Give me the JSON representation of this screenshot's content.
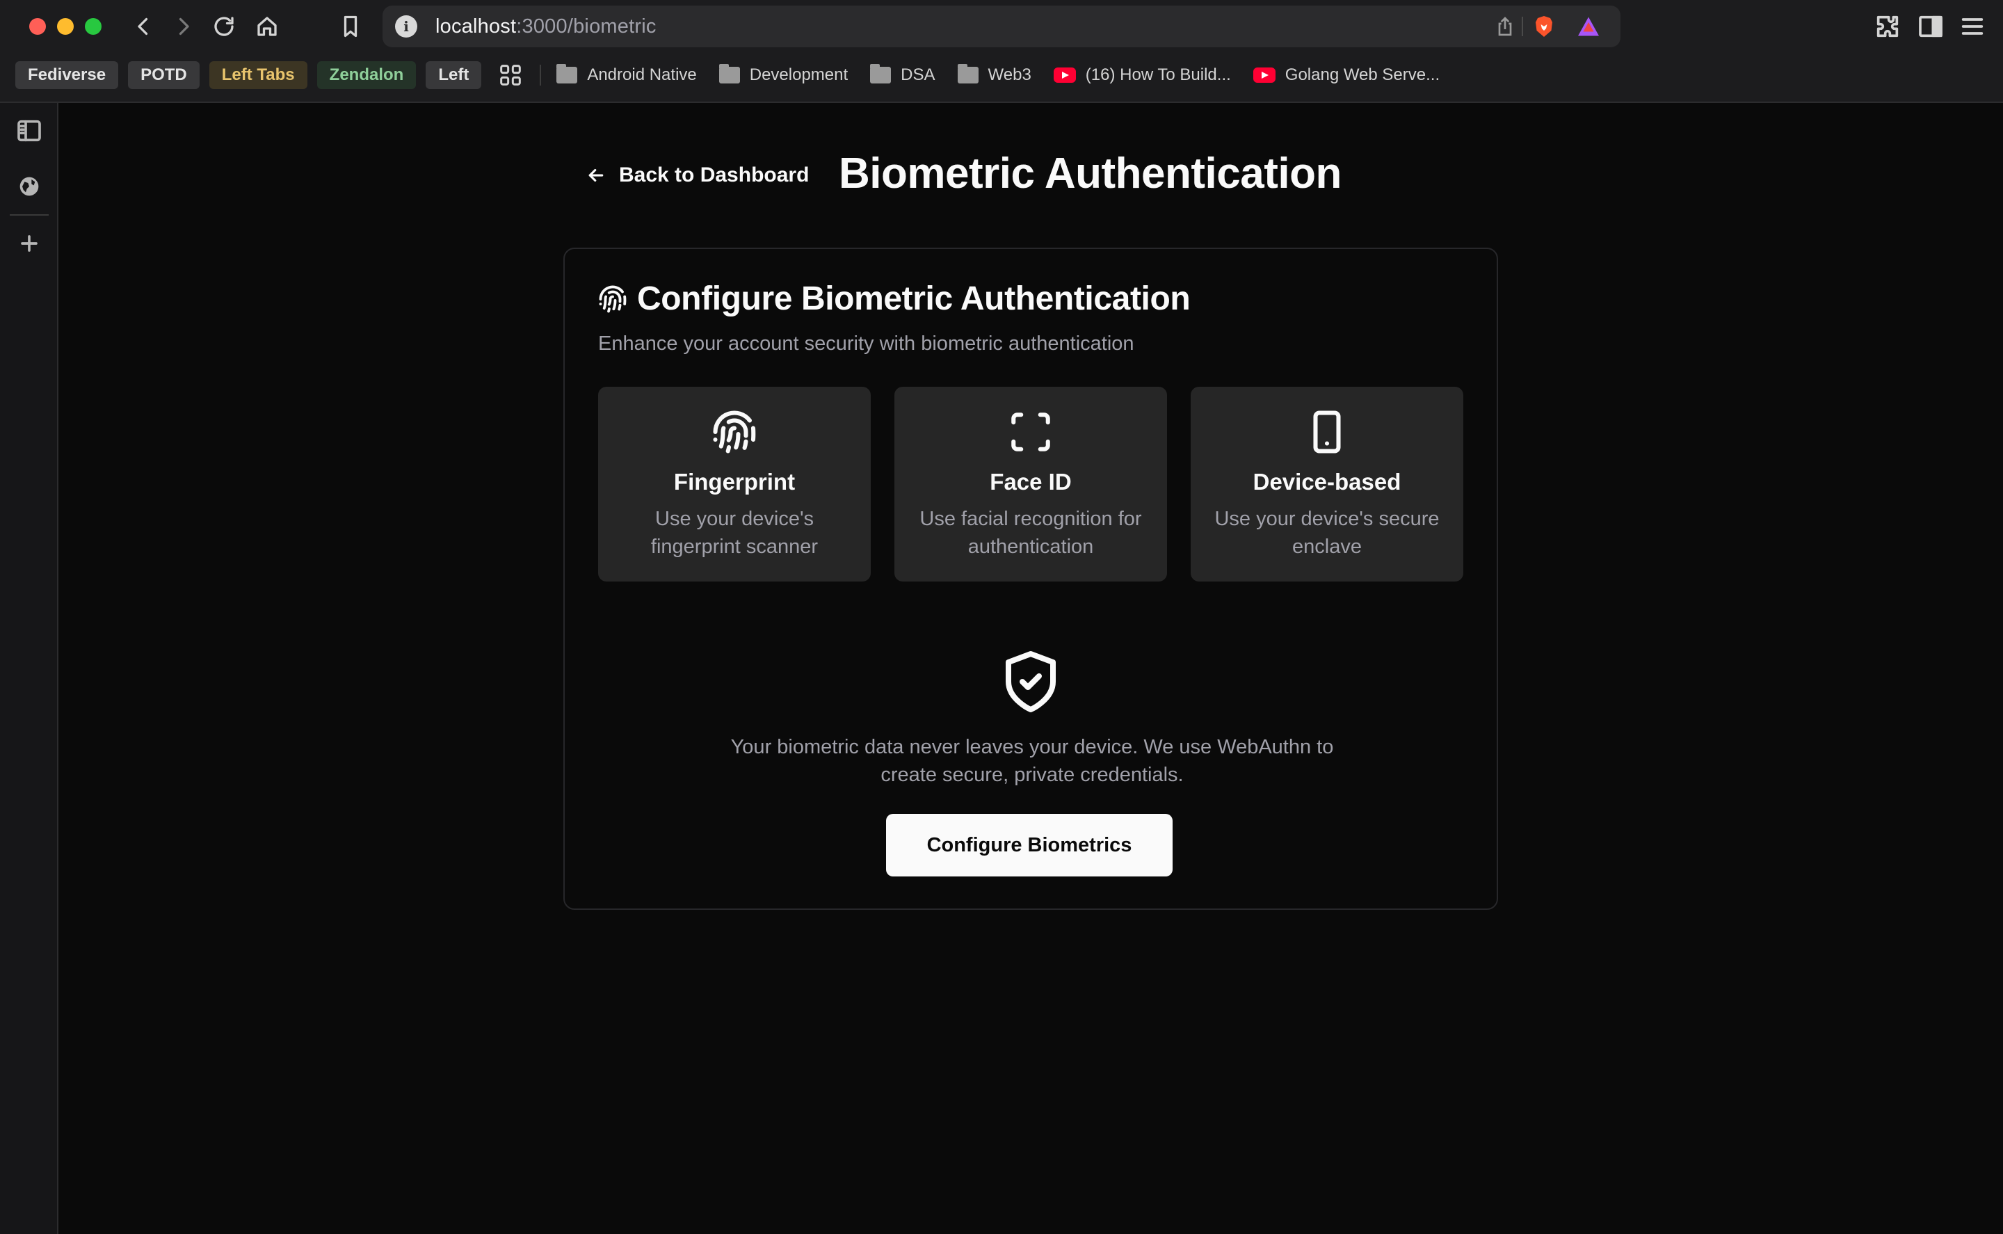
{
  "browser": {
    "url_host": "localhost",
    "url_path": ":3000/biometric",
    "info_glyph": "i",
    "bookmarks": {
      "chips": [
        {
          "label": "Fediverse",
          "style": "default"
        },
        {
          "label": "POTD",
          "style": "default"
        },
        {
          "label": "Left Tabs",
          "style": "yellow"
        },
        {
          "label": "Zendalon",
          "style": "green"
        },
        {
          "label": "Left",
          "style": "default"
        }
      ],
      "folders": [
        "Android Native",
        "Development",
        "DSA",
        "Web3"
      ],
      "videos": [
        "(16) How To Build...",
        "Golang Web Serve..."
      ]
    },
    "colors": {
      "red": "#ff5f57",
      "yellow": "#febc2e",
      "green": "#28c840"
    }
  },
  "page": {
    "back_label": "Back to Dashboard",
    "title": "Biometric Authentication"
  },
  "card": {
    "title": "Configure Biometric Authentication",
    "description": "Enhance your account security with biometric authentication",
    "methods": [
      {
        "icon": "fingerprint-icon",
        "title": "Fingerprint",
        "description": "Use your device's fingerprint scanner"
      },
      {
        "icon": "scan-face-icon",
        "title": "Face ID",
        "description": "Use facial recognition for authentication"
      },
      {
        "icon": "smartphone-icon",
        "title": "Device-based",
        "description": "Use your device's secure enclave"
      }
    ],
    "privacy_note": "Your biometric data never leaves your device. We use WebAuthn to create secure, private credentials.",
    "button_label": "Configure Biometrics"
  }
}
